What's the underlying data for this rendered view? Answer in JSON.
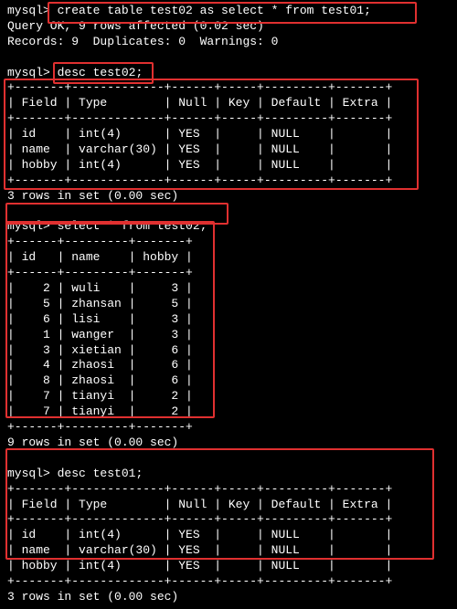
{
  "prompt": "mysql>",
  "cmd1": "create table test02 as select * from test01;",
  "res1a": "Query OK, 9 rows affected (0.02 sec)",
  "res1b": "Records: 9  Duplicates: 0  Warnings: 0",
  "cmd2": "desc test02;",
  "desc_border": "+-------+-------------+------+-----+---------+-------+",
  "desc_header": "| Field | Type        | Null | Key | Default | Extra |",
  "desc_rows": [
    "| id    | int(4)      | YES  |     | NULL    |       |",
    "| name  | varchar(30) | YES  |     | NULL    |       |",
    "| hobby | int(4)      | YES  |     | NULL    |       |"
  ],
  "res2": "3 rows in set (0.00 sec)",
  "cmd3": "select * from test02;",
  "sel_border": "+------+---------+-------+",
  "sel_header": "| id   | name    | hobby |",
  "sel_rows": [
    "|    2 | wuli    |     3 |",
    "|    5 | zhansan |     5 |",
    "|    6 | lisi    |     3 |",
    "|    1 | wanger  |     3 |",
    "|    3 | xietian |     6 |",
    "|    4 | zhaosi  |     6 |",
    "|    8 | zhaosi  |     6 |",
    "|    7 | tianyi  |     2 |",
    "|    7 | tianyi  |     2 |"
  ],
  "res3": "9 rows in set (0.00 sec)",
  "cmd4": "desc test01;",
  "res4": "3 rows in set (0.00 sec)",
  "chart_data": {
    "type": "table",
    "tables": [
      {
        "title": "desc test02",
        "columns": [
          "Field",
          "Type",
          "Null",
          "Key",
          "Default",
          "Extra"
        ],
        "rows": [
          [
            "id",
            "int(4)",
            "YES",
            "",
            "NULL",
            ""
          ],
          [
            "name",
            "varchar(30)",
            "YES",
            "",
            "NULL",
            ""
          ],
          [
            "hobby",
            "int(4)",
            "YES",
            "",
            "NULL",
            ""
          ]
        ]
      },
      {
        "title": "select * from test02",
        "columns": [
          "id",
          "name",
          "hobby"
        ],
        "rows": [
          [
            2,
            "wuli",
            3
          ],
          [
            5,
            "zhansan",
            5
          ],
          [
            6,
            "lisi",
            3
          ],
          [
            1,
            "wanger",
            3
          ],
          [
            3,
            "xietian",
            6
          ],
          [
            4,
            "zhaosi",
            6
          ],
          [
            8,
            "zhaosi",
            6
          ],
          [
            7,
            "tianyi",
            2
          ],
          [
            7,
            "tianyi",
            2
          ]
        ]
      },
      {
        "title": "desc test01",
        "columns": [
          "Field",
          "Type",
          "Null",
          "Key",
          "Default",
          "Extra"
        ],
        "rows": [
          [
            "id",
            "int(4)",
            "YES",
            "",
            "NULL",
            ""
          ],
          [
            "name",
            "varchar(30)",
            "YES",
            "",
            "NULL",
            ""
          ],
          [
            "hobby",
            "int(4)",
            "YES",
            "",
            "NULL",
            ""
          ]
        ]
      }
    ]
  }
}
